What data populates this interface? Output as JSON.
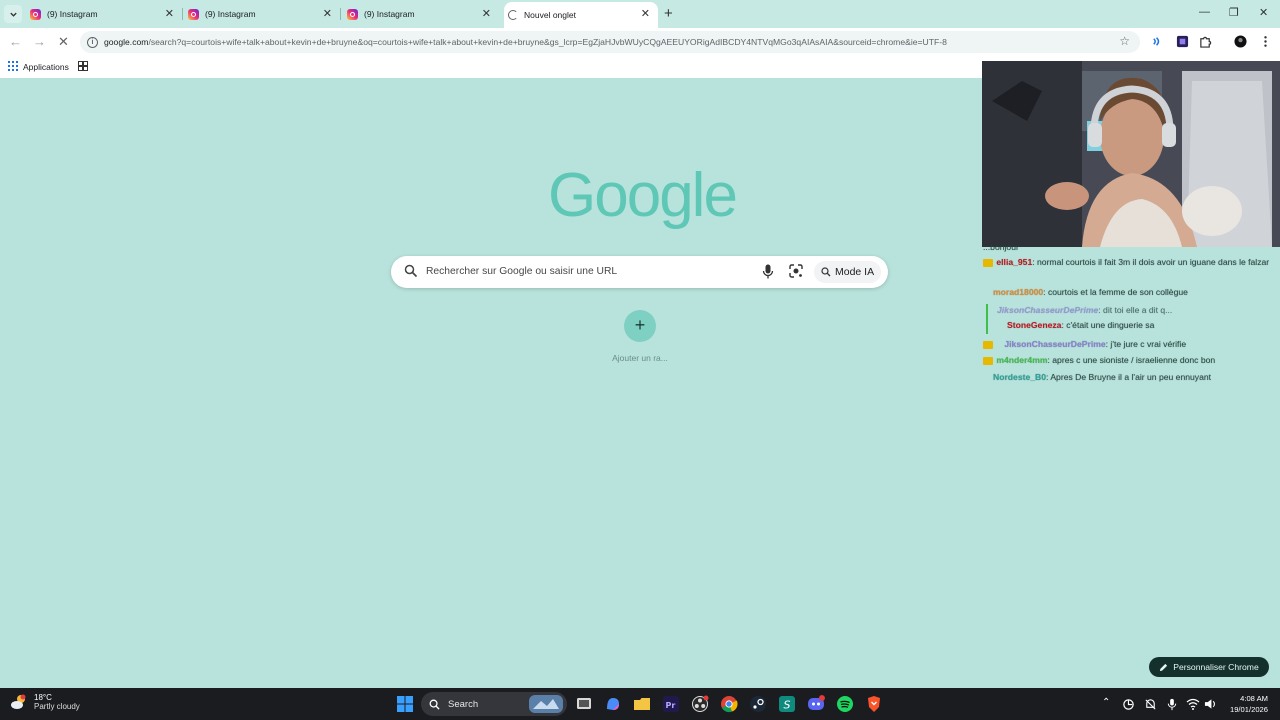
{
  "tabs": [
    {
      "title": "(9) Instagram",
      "active": false
    },
    {
      "title": "(9) Instagram",
      "active": false
    },
    {
      "title": "(9) Instagram",
      "active": false
    },
    {
      "title": "Nouvel onglet",
      "active": true
    }
  ],
  "address": {
    "host": "google.com",
    "path": "/search?q=courtois+wife+talk+about+kevin+de+bruyne&oq=courtois+wife+talk+about+kevin+de+bruyne&gs_lcrp=EgZjaHJvbWUyCQgAEEUYORigAdIBCDY4NTVqMGo3qAIAsAIA&sourceid=chrome&ie=UTF-8"
  },
  "bookmarks": {
    "apps_label": "Applications"
  },
  "ntp": {
    "logo": "Google",
    "search_placeholder": "Rechercher sur Google ou saisir une URL",
    "mode_label": "Mode IA",
    "shortcut_label": "Ajouter un ra...",
    "customize_label": "Personnaliser Chrome"
  },
  "chat": [
    {
      "user": "",
      "text": "...bonjour",
      "user_color": "#3fbf4a"
    },
    {
      "user": "ellia_951",
      "text": ": normal courtois il fait 3m il dois avoir un iguane dans le falzar",
      "user_color": "#c4161c"
    },
    {
      "user": "morad18000",
      "text": ": courtois et la femme de son collègue",
      "user_color": "#e08a2e"
    },
    {
      "user": "JiksonChasseurDePrime",
      "text": ": dit toi elle a dit q...",
      "user_color": "#8a7fd6"
    },
    {
      "user": "StoneGeneza",
      "text": ": c'était une dinguerie sa",
      "user_color": "#c4161c"
    },
    {
      "user": "JiksonChasseurDePrime",
      "text": ": j'te jure c vrai vérifie",
      "user_color": "#8a7fd6"
    },
    {
      "user": "m4nder4mm",
      "text": ": apres c une sioniste / israelienne donc bon",
      "user_color": "#3fbf4a"
    },
    {
      "user": "Nordeste_B0",
      "text": ": Apres De Bruyne il a l'air un peu ennuyant",
      "user_color": "#2aa198"
    }
  ],
  "taskbar": {
    "temp": "18°C",
    "condition": "Partly cloudy",
    "search_label": "Search",
    "time": "4:08 AM",
    "date": "19/01/2026"
  },
  "colors": {
    "background": "#b8e3dc",
    "tabstrip": "#c6e9e4",
    "logo": "#5fc7b6",
    "taskbar": "#1b1c20"
  }
}
